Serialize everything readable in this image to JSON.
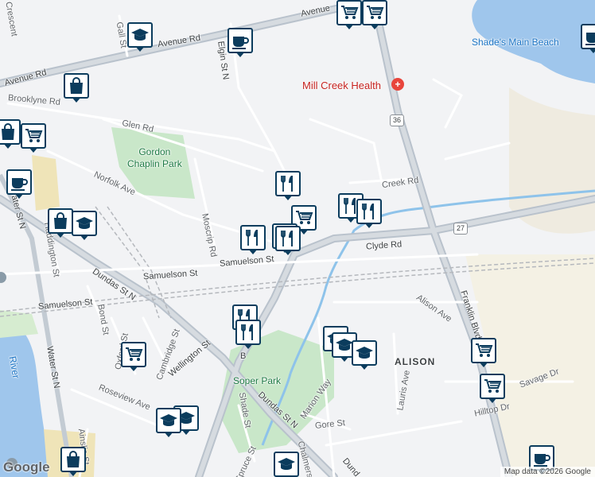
{
  "map": {
    "streets": [
      {
        "id": "avenue-rd-top",
        "text": "Avenue"
      },
      {
        "id": "avenue-rd-mid",
        "text": "Avenue Rd"
      },
      {
        "id": "avenue-rd-left",
        "text": "Avenue Rd"
      },
      {
        "id": "gall-st",
        "text": "Gall St"
      },
      {
        "id": "crescent",
        "text": "Crescent"
      },
      {
        "id": "elgin-st-n",
        "text": "Elgin St N"
      },
      {
        "id": "brooklyne-rd",
        "text": "Brooklyne Rd"
      },
      {
        "id": "glen-rd",
        "text": "Glen Rd"
      },
      {
        "id": "norfolk-ave",
        "text": "Norfolk Ave"
      },
      {
        "id": "moscrip-rd",
        "text": "Moscrip Rd"
      },
      {
        "id": "haddington-st",
        "text": "Haddington St"
      },
      {
        "id": "water-st-n-top",
        "text": "Water St N"
      },
      {
        "id": "water-st-n-bottom",
        "text": "Water St N"
      },
      {
        "id": "dundas-st-n-top",
        "text": "Dundas St N"
      },
      {
        "id": "dundas-st-n-bottom",
        "text": "Dundas St N"
      },
      {
        "id": "dundas-edge",
        "text": "Dund"
      },
      {
        "id": "samuelson-st-1",
        "text": "Samuelson St"
      },
      {
        "id": "samuelson-st-2",
        "text": "Samuelson St"
      },
      {
        "id": "samuelson-st-3",
        "text": "Samuelson St"
      },
      {
        "id": "clyde-rd",
        "text": "Clyde Rd"
      },
      {
        "id": "creek-rd",
        "text": "Creek Rd"
      },
      {
        "id": "franklin-blvd",
        "text": "Franklin Blvd"
      },
      {
        "id": "alison-ave",
        "text": "Alison Ave"
      },
      {
        "id": "lauris-ave",
        "text": "Lauris Ave"
      },
      {
        "id": "savage-dr",
        "text": "Savage Dr"
      },
      {
        "id": "hilltop-dr",
        "text": "Hilltop Dr"
      },
      {
        "id": "bond-st",
        "text": "Bond St"
      },
      {
        "id": "oxford-st",
        "text": "Oxford St"
      },
      {
        "id": "cambridge-st",
        "text": "Cambridge St"
      },
      {
        "id": "wellington-st",
        "text": "Wellington St"
      },
      {
        "id": "roseview-ave",
        "text": "Roseview Ave"
      },
      {
        "id": "ainslie-st",
        "text": "Ainslie St"
      },
      {
        "id": "marion-way",
        "text": "Marion Way"
      },
      {
        "id": "gore-st",
        "text": "Gore St"
      },
      {
        "id": "shade-st",
        "text": "Shade St"
      },
      {
        "id": "spruce-st",
        "text": "Spruce St"
      },
      {
        "id": "chalmers",
        "text": "Chalmers"
      },
      {
        "id": "b-letter",
        "text": "B"
      }
    ],
    "places": {
      "shades_beach": "Shade's Main Beach",
      "mill_creek": "Mill Creek Health",
      "gordon_park": "Gordon\nChaplin Park",
      "soper_park": "Soper Park",
      "alison": "ALISON",
      "river": "River"
    },
    "shields": [
      "36",
      "27"
    ],
    "attribution": "Map data ©2026 Google",
    "google_logo": "Google",
    "pins": [
      {
        "id": "pin-grocery-top-1",
        "icon": "grocery-cart-icon"
      },
      {
        "id": "pin-grocery-top-2",
        "icon": "grocery-cart-icon"
      },
      {
        "id": "pin-school-gall",
        "icon": "school-icon"
      },
      {
        "id": "pin-cafe-elgin",
        "icon": "coffee-cup-icon"
      },
      {
        "id": "pin-shopping-brooklyne",
        "icon": "shopping-bag-icon"
      },
      {
        "id": "pin-grocery-left",
        "icon": "grocery-cart-icon"
      },
      {
        "id": "pin-shopping-left",
        "icon": "shopping-bag-icon"
      },
      {
        "id": "pin-cafe-left",
        "icon": "coffee-cup-icon"
      },
      {
        "id": "pin-shopping-haddington",
        "icon": "shopping-bag-icon"
      },
      {
        "id": "pin-school-haddington",
        "icon": "school-icon"
      },
      {
        "id": "pin-restaurant-1",
        "icon": "restaurant-icon"
      },
      {
        "id": "pin-grocery-mid",
        "icon": "grocery-cart-icon"
      },
      {
        "id": "pin-restaurant-2",
        "icon": "restaurant-icon"
      },
      {
        "id": "pin-restaurant-3",
        "icon": "restaurant-icon"
      },
      {
        "id": "pin-restaurant-4",
        "icon": "restaurant-icon"
      },
      {
        "id": "pin-restaurant-5",
        "icon": "restaurant-icon"
      },
      {
        "id": "pin-restaurant-6",
        "icon": "restaurant-icon"
      },
      {
        "id": "pin-restaurant-7",
        "icon": "restaurant-icon"
      },
      {
        "id": "pin-restaurant-8",
        "icon": "restaurant-icon"
      },
      {
        "id": "pin-grocery-oxford",
        "icon": "grocery-cart-icon"
      },
      {
        "id": "pin-school-1",
        "icon": "school-icon"
      },
      {
        "id": "pin-school-2",
        "icon": "school-icon"
      },
      {
        "id": "pin-school-3",
        "icon": "school-icon"
      },
      {
        "id": "pin-school-4",
        "icon": "school-icon"
      },
      {
        "id": "pin-school-5",
        "icon": "school-icon"
      },
      {
        "id": "pin-grocery-franklin-1",
        "icon": "grocery-cart-icon"
      },
      {
        "id": "pin-grocery-franklin-2",
        "icon": "grocery-cart-icon"
      },
      {
        "id": "pin-shopping-bottom",
        "icon": "shopping-bag-icon"
      },
      {
        "id": "pin-school-bottom",
        "icon": "school-icon"
      },
      {
        "id": "pin-cafe-bottom",
        "icon": "coffee-cup-icon"
      },
      {
        "id": "pin-cafe-beach",
        "icon": "coffee-cup-icon"
      }
    ]
  }
}
